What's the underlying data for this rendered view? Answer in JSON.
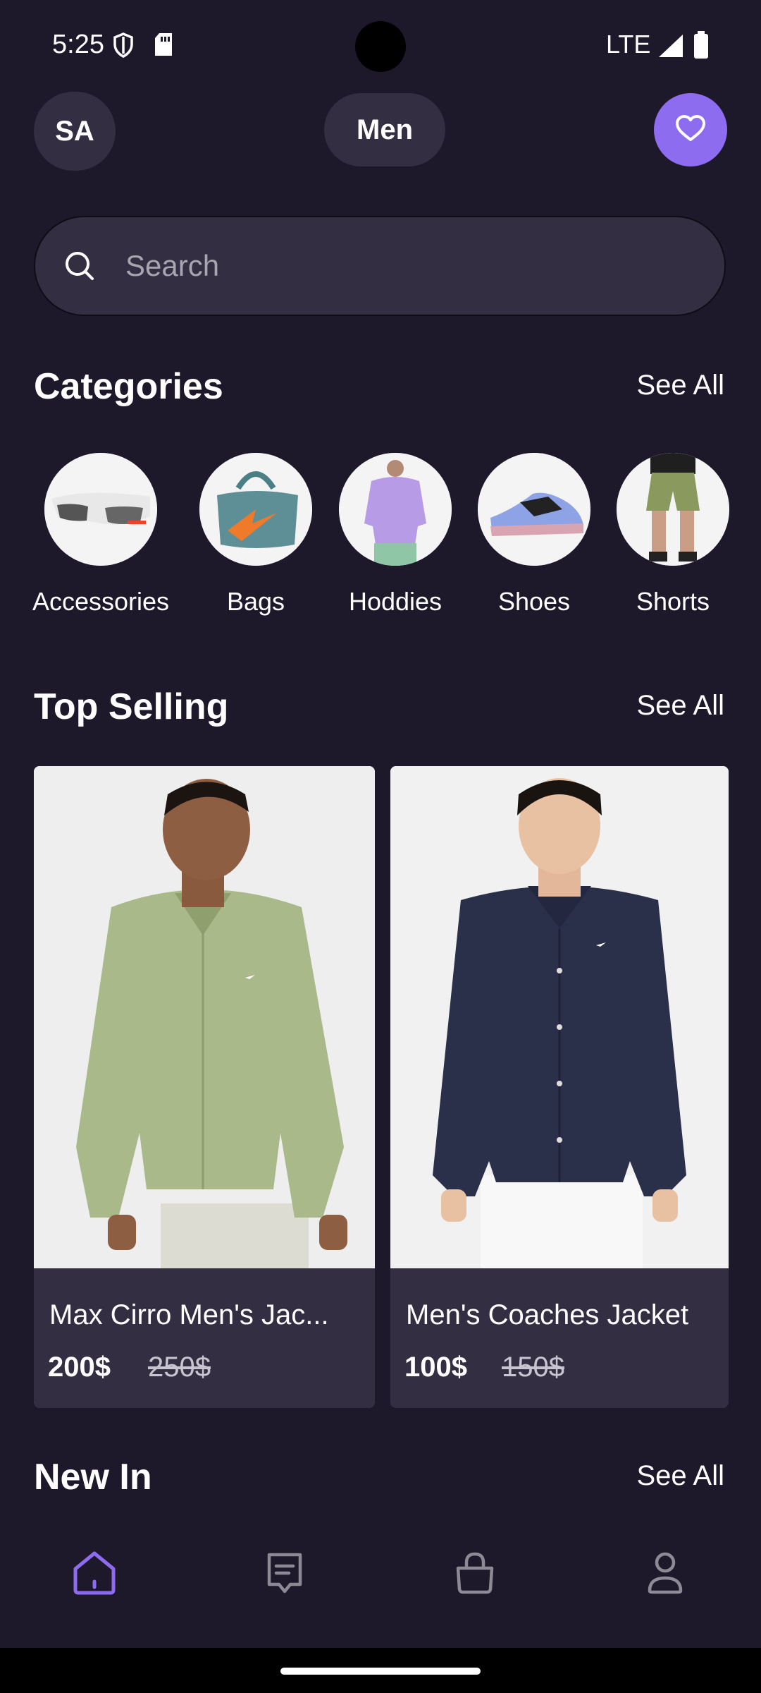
{
  "status": {
    "time": "5:25",
    "network": "LTE"
  },
  "header": {
    "avatar_initials": "SA",
    "gender": "Men"
  },
  "search": {
    "placeholder": "Search"
  },
  "categories_section": {
    "title": "Categories",
    "see_all": "See All"
  },
  "categories": [
    {
      "label": "Accessories"
    },
    {
      "label": "Bags"
    },
    {
      "label": "Hoddies"
    },
    {
      "label": "Shoes"
    },
    {
      "label": "Shorts"
    }
  ],
  "top_selling": {
    "title": "Top Selling",
    "see_all": "See All"
  },
  "products": [
    {
      "name": "Max Cirro Men's Jac...",
      "price": "200$",
      "old_price": "250$"
    },
    {
      "name": "Men's Coaches Jacket",
      "price": "100$",
      "old_price": "150$"
    }
  ],
  "new_in": {
    "title": "New In",
    "see_all": "See All"
  },
  "colors": {
    "accent": "#8e6cef",
    "background": "#1d182a",
    "surface": "#342e42"
  },
  "nav": {
    "items": [
      "home-icon",
      "orders-icon",
      "bag-icon",
      "profile-icon"
    ]
  }
}
